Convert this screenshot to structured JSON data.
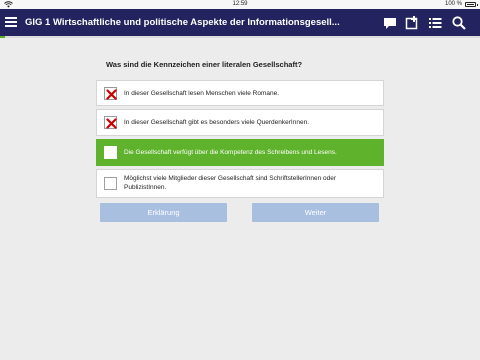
{
  "statusbar": {
    "time": "12:59",
    "battery": "100 %"
  },
  "header": {
    "title": "GIG 1 Wirtschaftliche und politische Aspekte der Informationsgesell..."
  },
  "icons": {
    "menu": "hamburger-menu-icon",
    "comments": "speech-bubble-icon",
    "note": "add-note-icon",
    "list": "list-icon",
    "search": "search-icon"
  },
  "colors": {
    "navbar": "#23235f",
    "correct": "#5fb22c",
    "wrong": "#cc0000",
    "button": "#a9bfe0",
    "progress": "#5aab2b"
  },
  "progress": 0.01,
  "quiz": {
    "question": "Was sind die Kennzeichen einer literalen Gesellschaft?",
    "answers": [
      {
        "text": "In dieser Gesellschaft lesen Menschen viele Romane.",
        "state": "wrong"
      },
      {
        "text": "In dieser Gesellschaft gibt es besonders viele QuerdenkerInnen.",
        "state": "wrong"
      },
      {
        "text": "Die Gesellschaft verfügt über die Kompetenz des Schreibens und Lesens.",
        "state": "selected"
      },
      {
        "text": "Möglichst viele Mitglieder dieser Gesellschaft sind SchriftstellerInnen oder PublizistInnen.",
        "state": "empty"
      }
    ]
  },
  "buttons": {
    "explain": "Erklärung",
    "next": "Weiter"
  }
}
